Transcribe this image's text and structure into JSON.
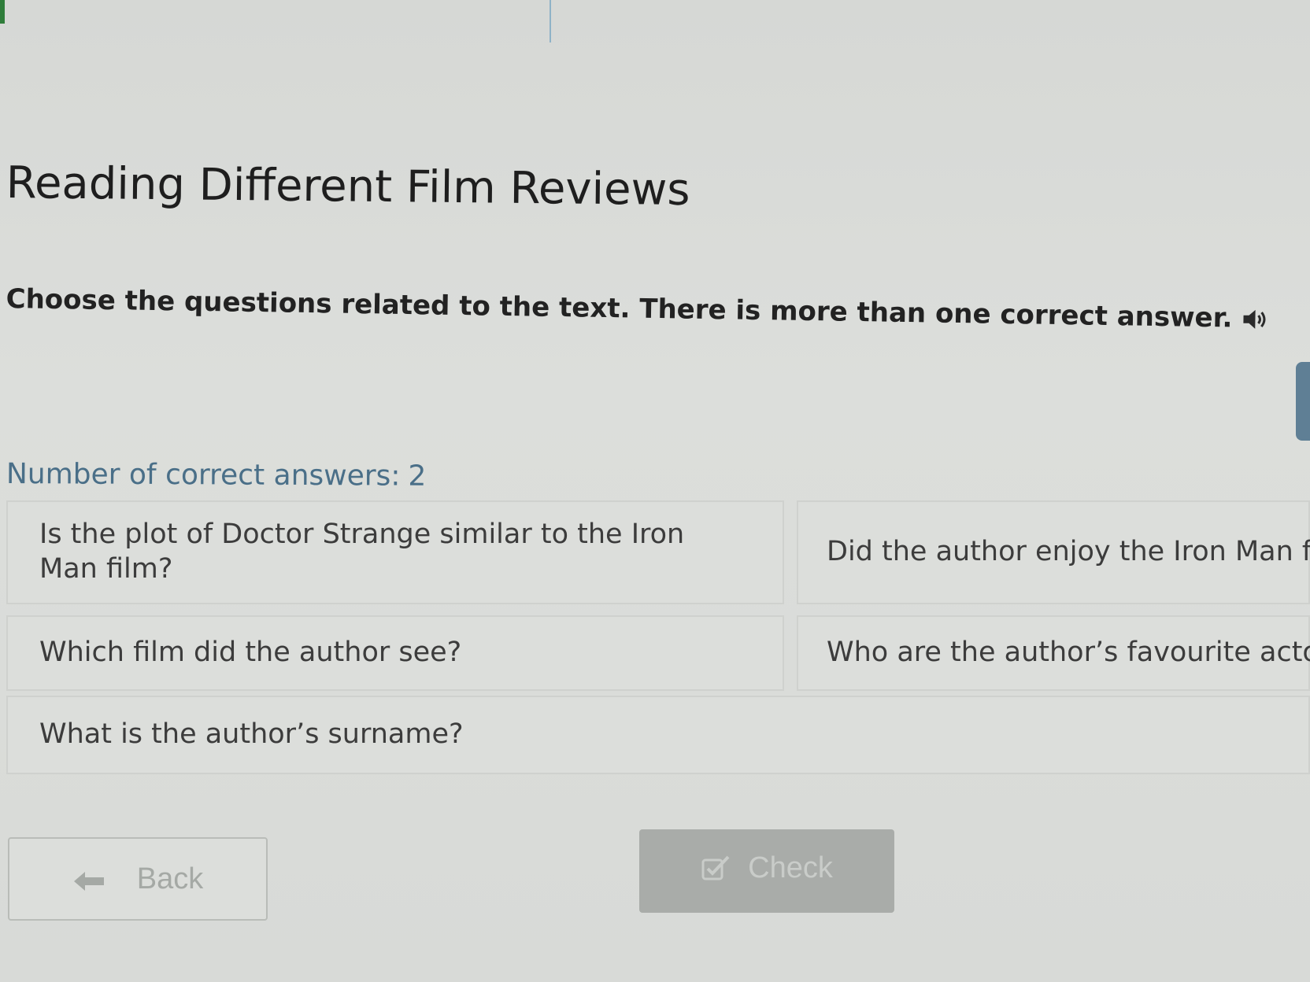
{
  "header": {
    "title": "Reading Different Film Reviews"
  },
  "task": {
    "instruction": "Choose the questions related to the text. There is more than one correct answer.",
    "audio_icon": "speaker-icon"
  },
  "answers_info": {
    "label": "Number of correct answers:",
    "count": "2"
  },
  "options": [
    {
      "text": "Is the plot of Doctor Strange similar to the Iron Man film?"
    },
    {
      "text": "Did the author enjoy the Iron Man film?"
    },
    {
      "text": "Which film did the author see?"
    },
    {
      "text": "Who are the author’s favourite actors?"
    },
    {
      "text": "What is the author’s surname?"
    }
  ],
  "footer": {
    "back_label": "Back",
    "back_icon": "arrow-left-icon",
    "check_label": "Check",
    "check_icon": "checkbox-icon"
  },
  "colors": {
    "background": "#d9dbd8",
    "count_text": "#4a6f88",
    "check_button": "#a9aca9",
    "top_accent": "#2f7d3a"
  }
}
